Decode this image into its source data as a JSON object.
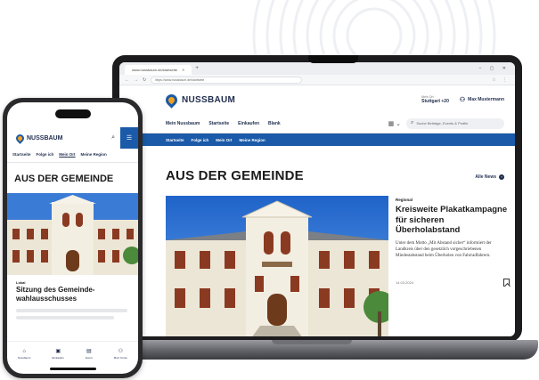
{
  "colors": {
    "brand_blue": "#1a5aa8",
    "brand_orange": "#f4a11c",
    "text_dark": "#1f2d4d"
  },
  "browser": {
    "tab_title": "www.nussbaum.de/startseite",
    "url": "https://www.nussbaum.de/startseite",
    "nav_icons": [
      "arrow-left-icon",
      "arrow-right-icon",
      "reload-icon"
    ]
  },
  "site": {
    "brand": "NUSSBAUM",
    "location_label": "Mein Ort",
    "location_value": "Stuttgart +20",
    "user_label": "Max Mustermann",
    "tabs": [
      "Mein Nussbaum",
      "Startseite",
      "Einkaufen",
      "Blank"
    ],
    "search_placeholder": "Suche Beiträge, Events & Profile",
    "blue_nav": [
      "Startseite",
      "Folge ich",
      "Mein Ort",
      "Meine Region"
    ],
    "section_title": "AUS DER GEMEINDE",
    "all_news_label": "Alle News",
    "article": {
      "kicker": "Regional",
      "headline": "Kreisweite Plakatkampagne für sicheren Überholabstand",
      "teaser": "Unter dem Motto „Mit Abstand sicher“ informiert der Landkreis über den gesetzlich vorgeschriebenen Mindestabstand beim Überholen von Fahrradfahrern.",
      "date": "14.03.2024"
    }
  },
  "phone": {
    "brand": "NUSSBAUM",
    "tabs": [
      "Startseite",
      "Folge ich",
      "Mein Ort",
      "Meine Region"
    ],
    "section_title": "AUS DER GEMEINDE",
    "article": {
      "kicker": "Lokal",
      "headline": "Sitzung des Gemeinde-wahlausschusses"
    },
    "bottom_nav": [
      {
        "label": "Nussbaum",
        "icon": "home-icon"
      },
      {
        "label": "Einkaufen",
        "icon": "bag-icon"
      },
      {
        "label": "Event",
        "icon": "calendar-icon"
      },
      {
        "label": "Mein Konto",
        "icon": "user-icon"
      }
    ]
  }
}
